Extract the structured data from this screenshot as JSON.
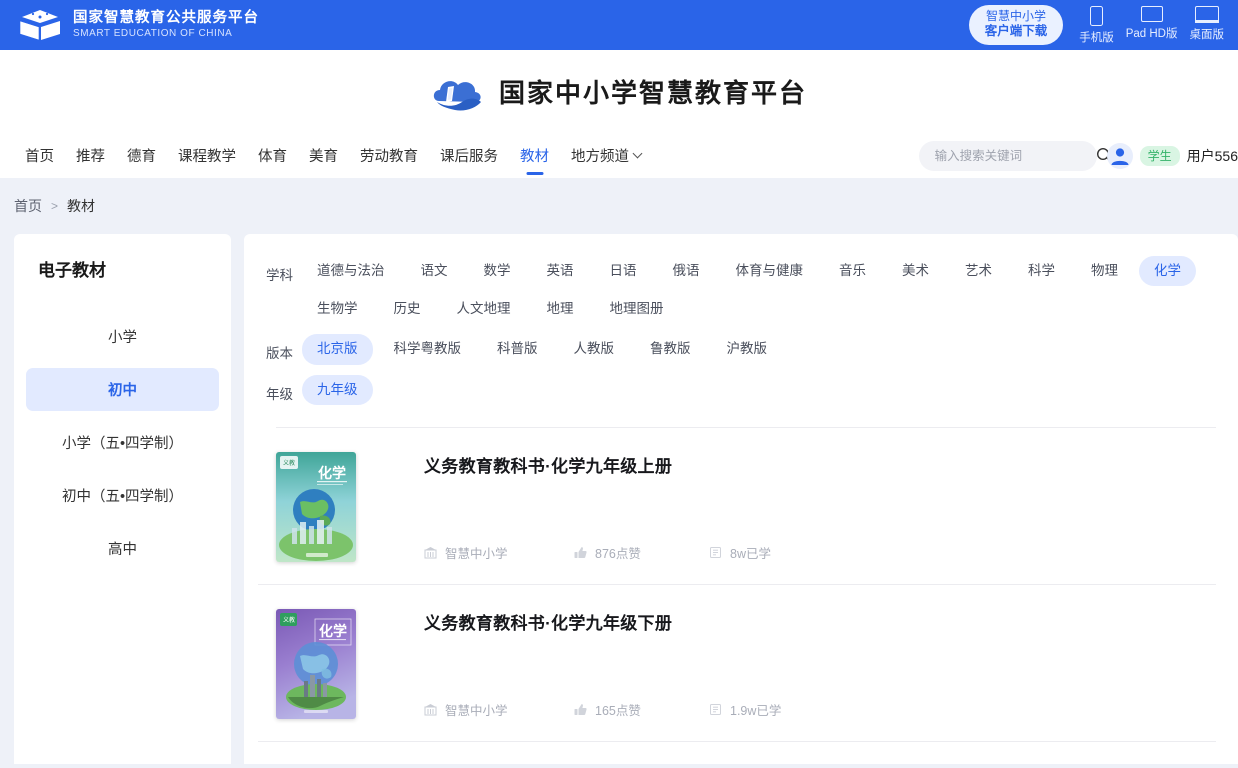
{
  "topbar": {
    "brand_cn": "国家智慧教育公共服务平台",
    "brand_en": "SMART EDUCATION OF CHINA",
    "client_download_line1": "智慧中小学",
    "client_download_line2": "客户端下载",
    "devices": [
      {
        "label": "手机版",
        "icon": "phone-icon"
      },
      {
        "label": "Pad HD版",
        "icon": "tablet-icon"
      },
      {
        "label": "桌面版",
        "icon": "desktop-icon"
      }
    ]
  },
  "masthead": {
    "title": "国家中小学智慧教育平台",
    "logo_icon": "cloud-book-logo-icon"
  },
  "nav": {
    "items": [
      {
        "label": "首页",
        "active": false
      },
      {
        "label": "推荐",
        "active": false
      },
      {
        "label": "德育",
        "active": false
      },
      {
        "label": "课程教学",
        "active": false
      },
      {
        "label": "体育",
        "active": false
      },
      {
        "label": "美育",
        "active": false
      },
      {
        "label": "劳动教育",
        "active": false
      },
      {
        "label": "课后服务",
        "active": false
      },
      {
        "label": "教材",
        "active": true
      },
      {
        "label": "地方频道",
        "active": false,
        "chevron": true
      }
    ],
    "search": {
      "placeholder": "输入搜索关键词",
      "value": "",
      "icon": "search-icon"
    },
    "user": {
      "avatar_icon": "user-avatar-icon",
      "role": "学生",
      "name": "用户556"
    }
  },
  "breadcrumb": {
    "home": "首页",
    "separator": ">",
    "current": "教材"
  },
  "sidebar": {
    "title": "电子教材",
    "items": [
      {
        "label": "小学",
        "active": false
      },
      {
        "label": "初中",
        "active": true
      },
      {
        "label": "小学（五•四学制）",
        "active": false
      },
      {
        "label": "初中（五•四学制）",
        "active": false
      },
      {
        "label": "高中",
        "active": false
      }
    ]
  },
  "filters": [
    {
      "label": "学科",
      "options": [
        {
          "label": "道德与法治",
          "active": false
        },
        {
          "label": "语文",
          "active": false
        },
        {
          "label": "数学",
          "active": false
        },
        {
          "label": "英语",
          "active": false
        },
        {
          "label": "日语",
          "active": false
        },
        {
          "label": "俄语",
          "active": false
        },
        {
          "label": "体育与健康",
          "active": false
        },
        {
          "label": "音乐",
          "active": false
        },
        {
          "label": "美术",
          "active": false
        },
        {
          "label": "艺术",
          "active": false
        },
        {
          "label": "科学",
          "active": false
        },
        {
          "label": "物理",
          "active": false
        },
        {
          "label": "化学",
          "active": true
        },
        {
          "label": "生物学",
          "active": false
        },
        {
          "label": "历史",
          "active": false
        },
        {
          "label": "人文地理",
          "active": false
        },
        {
          "label": "地理",
          "active": false
        },
        {
          "label": "地理图册",
          "active": false
        }
      ]
    },
    {
      "label": "版本",
      "options": [
        {
          "label": "北京版",
          "active": true
        },
        {
          "label": "科学粤教版",
          "active": false
        },
        {
          "label": "科普版",
          "active": false
        },
        {
          "label": "人教版",
          "active": false
        },
        {
          "label": "鲁教版",
          "active": false
        },
        {
          "label": "沪教版",
          "active": false
        }
      ]
    },
    {
      "label": "年级",
      "options": [
        {
          "label": "九年级",
          "active": true
        }
      ]
    }
  ],
  "books": [
    {
      "title": "义务教育教科书·化学九年级上册",
      "publisher": "智慧中小学",
      "likes": "876点赞",
      "learners": "8w已学",
      "cover_theme": "green",
      "cover_subject": "化学",
      "publisher_icon": "institution-icon",
      "likes_icon": "thumbs-up-icon",
      "learners_icon": "study-book-icon"
    },
    {
      "title": "义务教育教科书·化学九年级下册",
      "publisher": "智慧中小学",
      "likes": "165点赞",
      "learners": "1.9w已学",
      "cover_theme": "purple",
      "cover_subject": "化学",
      "publisher_icon": "institution-icon",
      "likes_icon": "thumbs-up-icon",
      "learners_icon": "study-book-icon"
    }
  ],
  "colors": {
    "brand_blue": "#2a64e8",
    "chip_active_bg": "#e2eaff",
    "role_badge_green": "#35b36a",
    "page_bg": "#eef1f8"
  }
}
